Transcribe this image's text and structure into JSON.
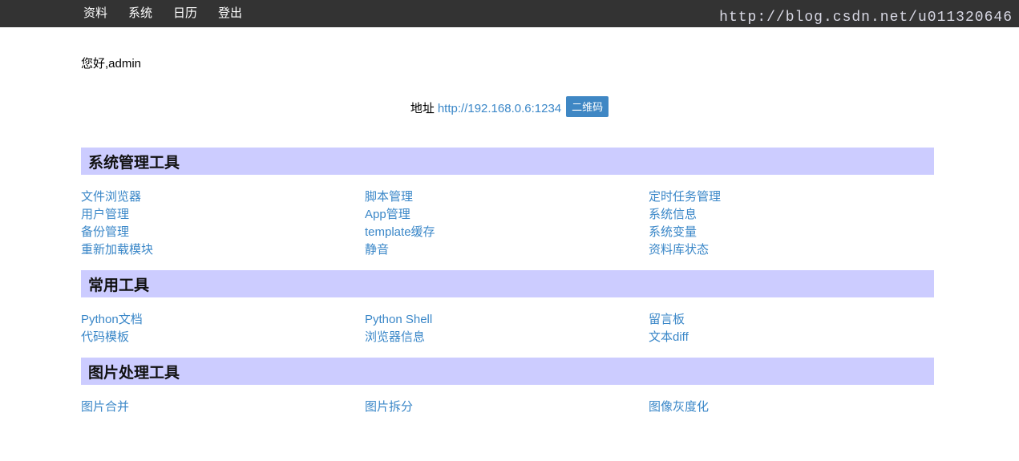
{
  "navbar": {
    "items": [
      {
        "label": "资料"
      },
      {
        "label": "系统"
      },
      {
        "label": "日历"
      },
      {
        "label": "登出"
      }
    ]
  },
  "greeting": "您好,admin",
  "address": {
    "label": "地址",
    "url": "http://192.168.0.6:1234",
    "qr_button": "二维码"
  },
  "colors": {
    "navbar_bg": "#333333",
    "section_header_bg": "#ccccff",
    "link": "#3a87c8",
    "badge_bg": "#3f87c4",
    "watermark": "#d8d8e4"
  },
  "sections": [
    {
      "title": "系统管理工具",
      "columns": [
        [
          "文件浏览器",
          "用户管理",
          "备份管理",
          "重新加载模块"
        ],
        [
          "脚本管理",
          "App管理",
          "template缓存",
          "静音"
        ],
        [
          "定时任务管理",
          "系统信息",
          "系统变量",
          "资料库状态"
        ]
      ]
    },
    {
      "title": "常用工具",
      "columns": [
        [
          "Python文档",
          "代码模板"
        ],
        [
          "Python Shell",
          "浏览器信息"
        ],
        [
          "留言板",
          "文本diff"
        ]
      ]
    },
    {
      "title": "图片处理工具",
      "columns": [
        [
          "图片合并"
        ],
        [
          "图片拆分"
        ],
        [
          "图像灰度化"
        ]
      ]
    }
  ],
  "watermark": "http://blog.csdn.net/u011320646"
}
